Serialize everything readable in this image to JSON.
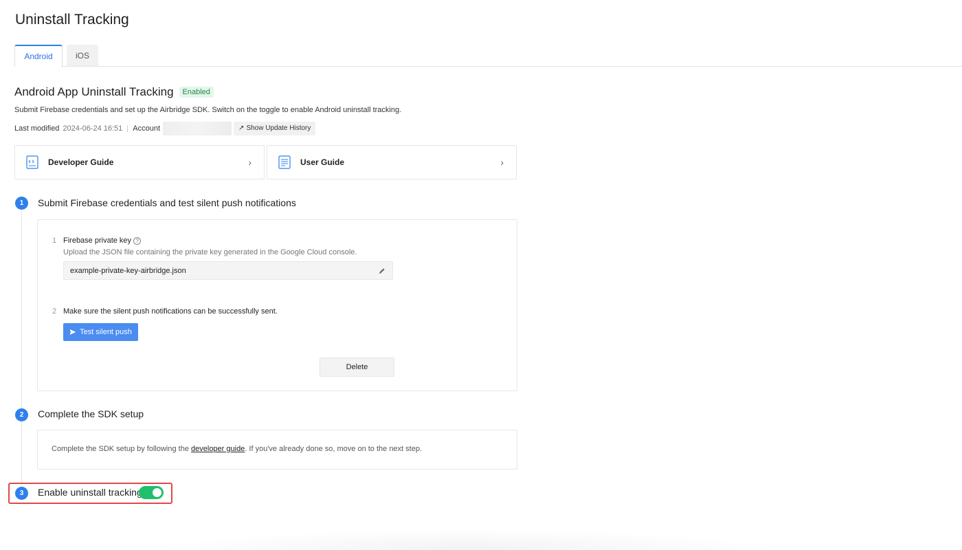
{
  "page": {
    "title": "Uninstall Tracking"
  },
  "tabs": [
    {
      "label": "Android",
      "active": true
    },
    {
      "label": "iOS",
      "active": false
    }
  ],
  "section": {
    "title": "Android App Uninstall Tracking",
    "status_badge": "Enabled",
    "description": "Submit Firebase credentials and set up the Airbridge SDK. Switch on the toggle to enable Android uninstall tracking.",
    "last_modified_label": "Last modified",
    "last_modified_value": "2024-06-24 16:51",
    "account_label": "Account",
    "history_button": "Show Update History"
  },
  "guides": {
    "developer": {
      "label": "Developer Guide",
      "icon": "code-doc-icon"
    },
    "user": {
      "label": "User Guide",
      "icon": "doc-icon"
    }
  },
  "steps": [
    {
      "number": "1",
      "title": "Submit Firebase credentials and test silent push notifications"
    },
    {
      "number": "2",
      "title": "Complete the SDK setup"
    },
    {
      "number": "3",
      "title": "Enable uninstall tracking"
    }
  ],
  "step1": {
    "item1": {
      "number": "1",
      "title": "Firebase private key",
      "help_icon": "?",
      "description": "Upload the JSON file containing the private key generated in the Google Cloud console.",
      "file_name": "example-private-key-airbridge.json"
    },
    "item2": {
      "number": "2",
      "title": "Make sure the silent push notifications can be successfully sent.",
      "test_button": "Test silent push"
    },
    "delete_button": "Delete"
  },
  "step2": {
    "text_before": "Complete the SDK setup by following the ",
    "link": "developer guide",
    "text_after": ". If you've already done so, move on to the next step."
  },
  "step3": {
    "toggle_on": true
  },
  "colors": {
    "accent": "#2f80ed",
    "toggle_on": "#1fbf6c",
    "badge_bg": "#e4f6ea",
    "badge_text": "#1f8a4c",
    "highlight": "#e04848"
  }
}
